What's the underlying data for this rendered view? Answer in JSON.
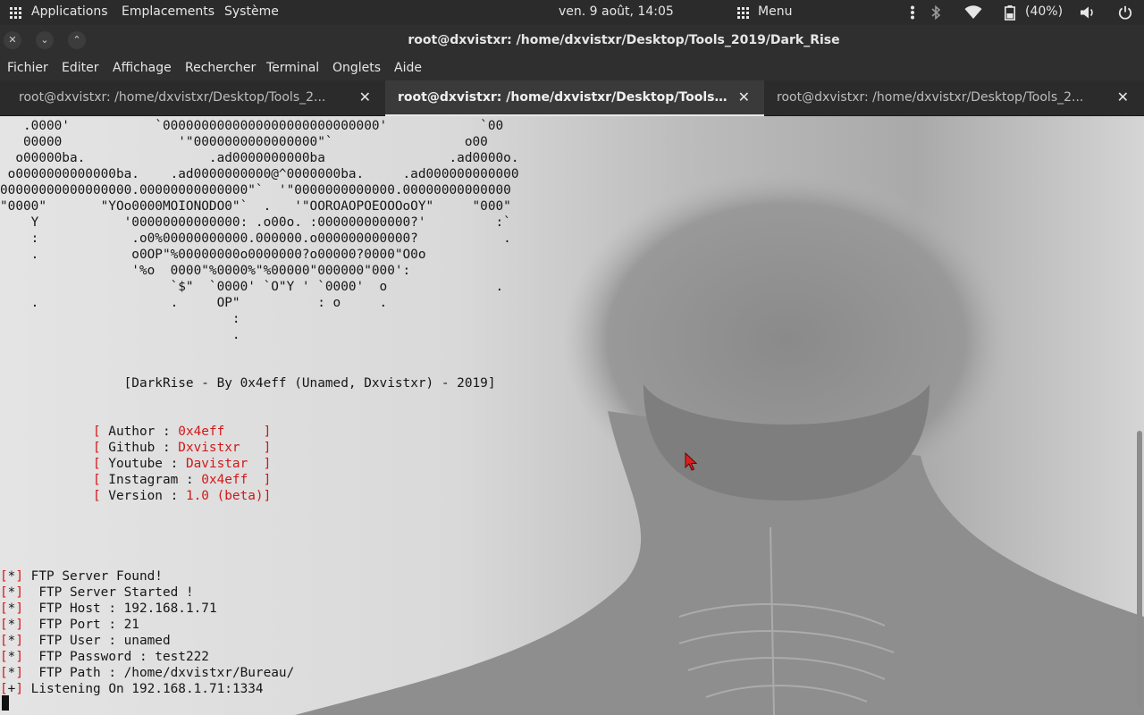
{
  "top_panel": {
    "applications": "Applications",
    "places": "Emplacements",
    "system": "Système",
    "clock": "ven.  9 août, 14:05",
    "menu": "Menu",
    "battery": "(40%)"
  },
  "window": {
    "title": "root@dxvistxr: /home/dxvistxr/Desktop/Tools_2019/Dark_Rise",
    "close_glyph": "✕",
    "minimize_glyph": "⌄",
    "maximize_glyph": "⌃"
  },
  "menubar": {
    "items": [
      "Fichier",
      "Editer",
      "Affichage",
      "Rechercher",
      "Terminal",
      "Onglets",
      "Aide"
    ]
  },
  "tabs": [
    {
      "label": "root@dxvistxr: /home/dxvistxr/Desktop/Tools_2...",
      "close": "✕"
    },
    {
      "label": "root@dxvistxr: /home/dxvistxr/Desktop/Tools_2...",
      "close": "✕"
    },
    {
      "label": "root@dxvistxr: /home/dxvistxr/Desktop/Tools_2...",
      "close": "✕"
    }
  ],
  "terminal": {
    "ascii_art": [
      "   .0000'           `0000000000000000000000000000'            `00",
      "   00000               '\"0000000000000000\"`                 o00",
      "  o00000ba.                .ad0000000000ba                .ad0000o.",
      " o0000000000000ba.    .ad0000000000@^0000000ba.     .ad000000000000",
      "00000000000000000.00000000000000\"`  '\"0000000000000.00000000000000",
      "\"0000\"       \"YOo0000MOIONODO0\"`  .   '\"OOROAOPOEOOOoOY\"     \"000\"",
      "    Y           '00000000000000: .o00o. :000000000000?'         :`",
      "    :            .o0%00000000000.000000.o000000000000?           .",
      "    .            o0OP\"%00000000o0000000?o00000?0000\"O0o",
      "                 '%o  0000\"%0000%\"%00000\"000000\"000':",
      "                      `$\"  `0000' `O\"Y ' `0000'  o              .",
      "    .                 .     OP\"          : o     .",
      "                              :",
      "                              ."
    ],
    "banner": "[DarkRise - By 0x4eff (Unamed, Dxvistxr) - 2019]",
    "info": [
      {
        "key": "Author",
        "value": "0x4eff    "
      },
      {
        "key": "Github",
        "value": "Dxvistxr  "
      },
      {
        "key": "Youtube",
        "value": "Davistar "
      },
      {
        "key": "Instagram",
        "value": "0x4eff "
      },
      {
        "key": "Version",
        "value": "1.0 (beta)"
      }
    ],
    "log": [
      {
        "tag": "*",
        "text": " FTP Server Found!"
      },
      {
        "tag": "*",
        "text": "  FTP Server Started !"
      },
      {
        "tag": "*",
        "text": "  FTP Host : 192.168.1.71"
      },
      {
        "tag": "*",
        "text": "  FTP Port : 21"
      },
      {
        "tag": "*",
        "text": "  FTP User : unamed"
      },
      {
        "tag": "*",
        "text": "  FTP Password : test222"
      },
      {
        "tag": "*",
        "text": "  FTP Path : /home/dxvistxr/Bureau/"
      },
      {
        "tag": "+",
        "text": " Listening On 192.168.1.71:1334"
      }
    ]
  },
  "colors": {
    "accent_red": "#d01818",
    "panel_bg": "#2b2b2b",
    "terminal_fg": "#161616"
  },
  "icons": [
    "apps-grid-icon",
    "menu-grid-icon",
    "more-vert-icon",
    "bluetooth-icon",
    "wifi-icon",
    "battery-icon",
    "volume-icon",
    "power-icon",
    "mouse-pointer-icon"
  ]
}
